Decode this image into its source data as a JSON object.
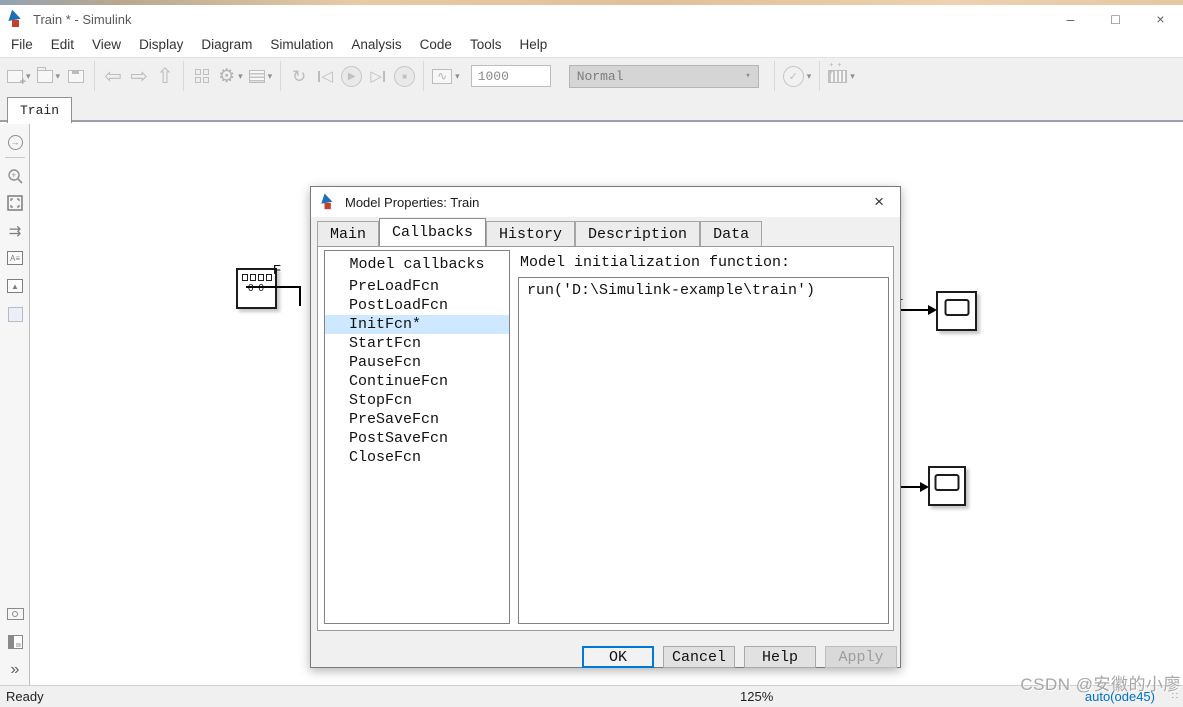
{
  "window": {
    "title": "Train * - Simulink",
    "controls": {
      "minimize": "–",
      "maximize": "□",
      "close": "×"
    }
  },
  "menu": {
    "items": [
      "File",
      "Edit",
      "View",
      "Display",
      "Diagram",
      "Simulation",
      "Analysis",
      "Code",
      "Tools",
      "Help"
    ]
  },
  "toolbar": {
    "stop_time": "1000",
    "mode": "Normal"
  },
  "icons": {
    "back": "⇦",
    "forward": "⇨",
    "up": "⇧",
    "gear": "⚙",
    "update": "↻",
    "run": "▶",
    "stop": "■",
    "step_back": "◁",
    "step_forward": "▷",
    "wave": "∿",
    "check": "✓",
    "caret": "▾",
    "hide_arrow": "→",
    "signal": "⇉",
    "annotation": "A≡",
    "mountain": "▲",
    "zoom_plus": "+",
    "fit": "⤢",
    "expand": "»",
    "grip": "∷"
  },
  "model_tab": {
    "label": "Train"
  },
  "canvas": {
    "display_value": "0 0",
    "wire_label_f": "F",
    "wire_label_1": "1"
  },
  "dialog": {
    "title": "Model Properties: Train",
    "close": "×",
    "tabs": [
      "Main",
      "Callbacks",
      "History",
      "Description",
      "Data"
    ],
    "active_tab": "Callbacks",
    "callbacks": {
      "header": "Model callbacks",
      "items": [
        "PreLoadFcn",
        "PostLoadFcn",
        "InitFcn*",
        "StartFcn",
        "PauseFcn",
        "ContinueFcn",
        "StopFcn",
        "PreSaveFcn",
        "PostSaveFcn",
        "CloseFcn"
      ],
      "selected": "InitFcn*"
    },
    "editor": {
      "label": "Model initialization function:",
      "value": "run('D:\\Simulink-example\\train')"
    },
    "buttons": {
      "ok": "OK",
      "cancel": "Cancel",
      "help": "Help",
      "apply": "Apply"
    }
  },
  "statusbar": {
    "ready": "Ready",
    "zoom": "125%",
    "solver": "auto(ode45)"
  },
  "watermark": "CSDN @安徽的小廖",
  "colors": {
    "accent": "#0078d7",
    "selection": "#cde8ff",
    "solver_blue": "#0070c0",
    "canvas": "#ffffff",
    "chrome": "#f0f0f0"
  }
}
